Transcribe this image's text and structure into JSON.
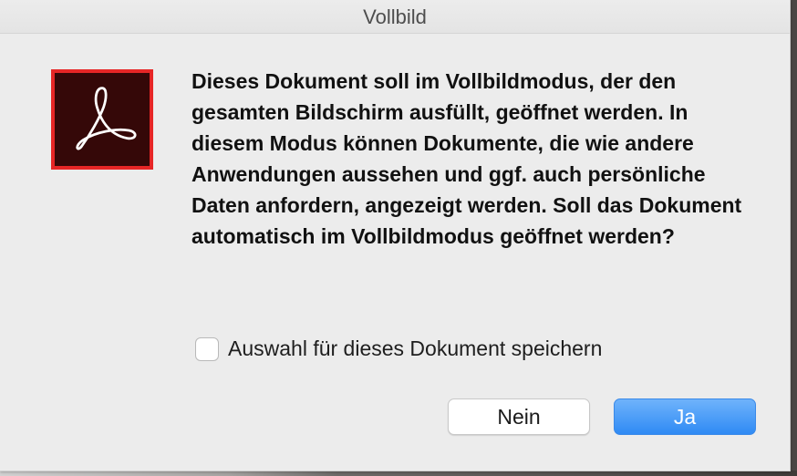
{
  "window": {
    "title": "Vollbild"
  },
  "dialog": {
    "icon": "adobe-acrobat-icon",
    "message": "Dieses Dokument soll im Vollbildmodus, der den gesamten Bildschirm ausfüllt, geöffnet werden. In diesem Modus können Dokumente, die wie andere Anwendungen aussehen und ggf. auch persönliche Daten anfordern, angezeigt werden. Soll das Dokument automatisch im Vollbildmodus geöffnet werden?",
    "checkbox": {
      "label": "Auswahl für dieses Dokument speichern",
      "checked": false
    },
    "buttons": {
      "no_label": "Nein",
      "yes_label": "Ja"
    }
  },
  "colors": {
    "icon_border": "#e62626",
    "icon_background": "#350808",
    "primary_button": "#2f8af4"
  }
}
